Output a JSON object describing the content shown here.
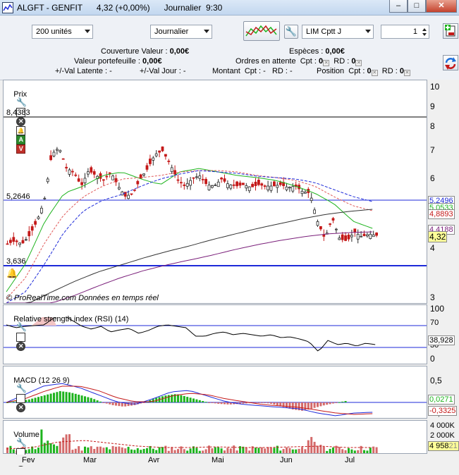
{
  "window": {
    "title": "ALGFT - GENFIT      4,32 (+0,00%)      Journalier  9:30",
    "btn_min": "–",
    "btn_max": "□",
    "btn_close": "✕"
  },
  "toolbar": {
    "quantity": "200 unités",
    "period": "Journalier",
    "order_type": "LIM Cptt J",
    "spinner_value": "1"
  },
  "account": {
    "couverture_label": "Couverture Valeur : ",
    "couverture_value": "0,00€",
    "especes_label": "Espèces : ",
    "especes_value": "0,00€",
    "portefeuille_label": "Valeur portefeuille : ",
    "portefeuille_value": "0,00€",
    "ordres_label": "Ordres en attente  Cpt : ",
    "ordres_cpt": "0",
    "ordres_rd_label": "RD : ",
    "ordres_rd": "0",
    "latente": "+/-Val Latente : -",
    "jour": "+/-Val Jour : -",
    "montant": "Montant  Cpt : -   RD : -",
    "position_label": "Position  Cpt : ",
    "position_cpt": "0",
    "position_rd_label": "RD : ",
    "position_rd": "0"
  },
  "price_pane": {
    "title": "Prix",
    "btn_a": "A",
    "btn_v": "V",
    "level_high": "8,4383",
    "level_mid": "5,2646",
    "level_low": "3,636",
    "watermark": "© ProRealTime.com  Données en temps réel",
    "axis_ticks": [
      "10",
      "9",
      "8",
      "7",
      "6",
      "5",
      "4",
      "3"
    ],
    "val_ma_dash": "5,2496",
    "val_ma2": "5,0533",
    "val_ma3": "4,8893",
    "val_ma4": "4,4188",
    "val_last": "4,32"
  },
  "rsi_pane": {
    "title": "Relative strength index (RSI) (14)",
    "axis_ticks": [
      "100",
      "70",
      "30",
      "0"
    ],
    "value": "38,928"
  },
  "macd_pane": {
    "title": "MACD (12 26 9)",
    "axis_ticks": [
      "0,5",
      "0",
      "-0,5"
    ],
    "val_hist": "0,0271",
    "val_signal": "-0,3325"
  },
  "volume_pane": {
    "title": "Volume",
    "axis_ticks": [
      "4 000K",
      "2 000K"
    ],
    "value": "4 958",
    "value_tail": "21"
  },
  "date_axis": [
    "Fev",
    "Mar",
    "Avr",
    "Mai",
    "Jun",
    "Jul"
  ],
  "colors": {
    "candle_up": "#2a2a2a",
    "candle_down": "#c41919",
    "ma_green": "#1db31d",
    "ma_red": "#e05a5a",
    "ma_blue": "#1d2ad9",
    "ma_black": "#333333",
    "ma_purple": "#7a1f7a"
  }
}
